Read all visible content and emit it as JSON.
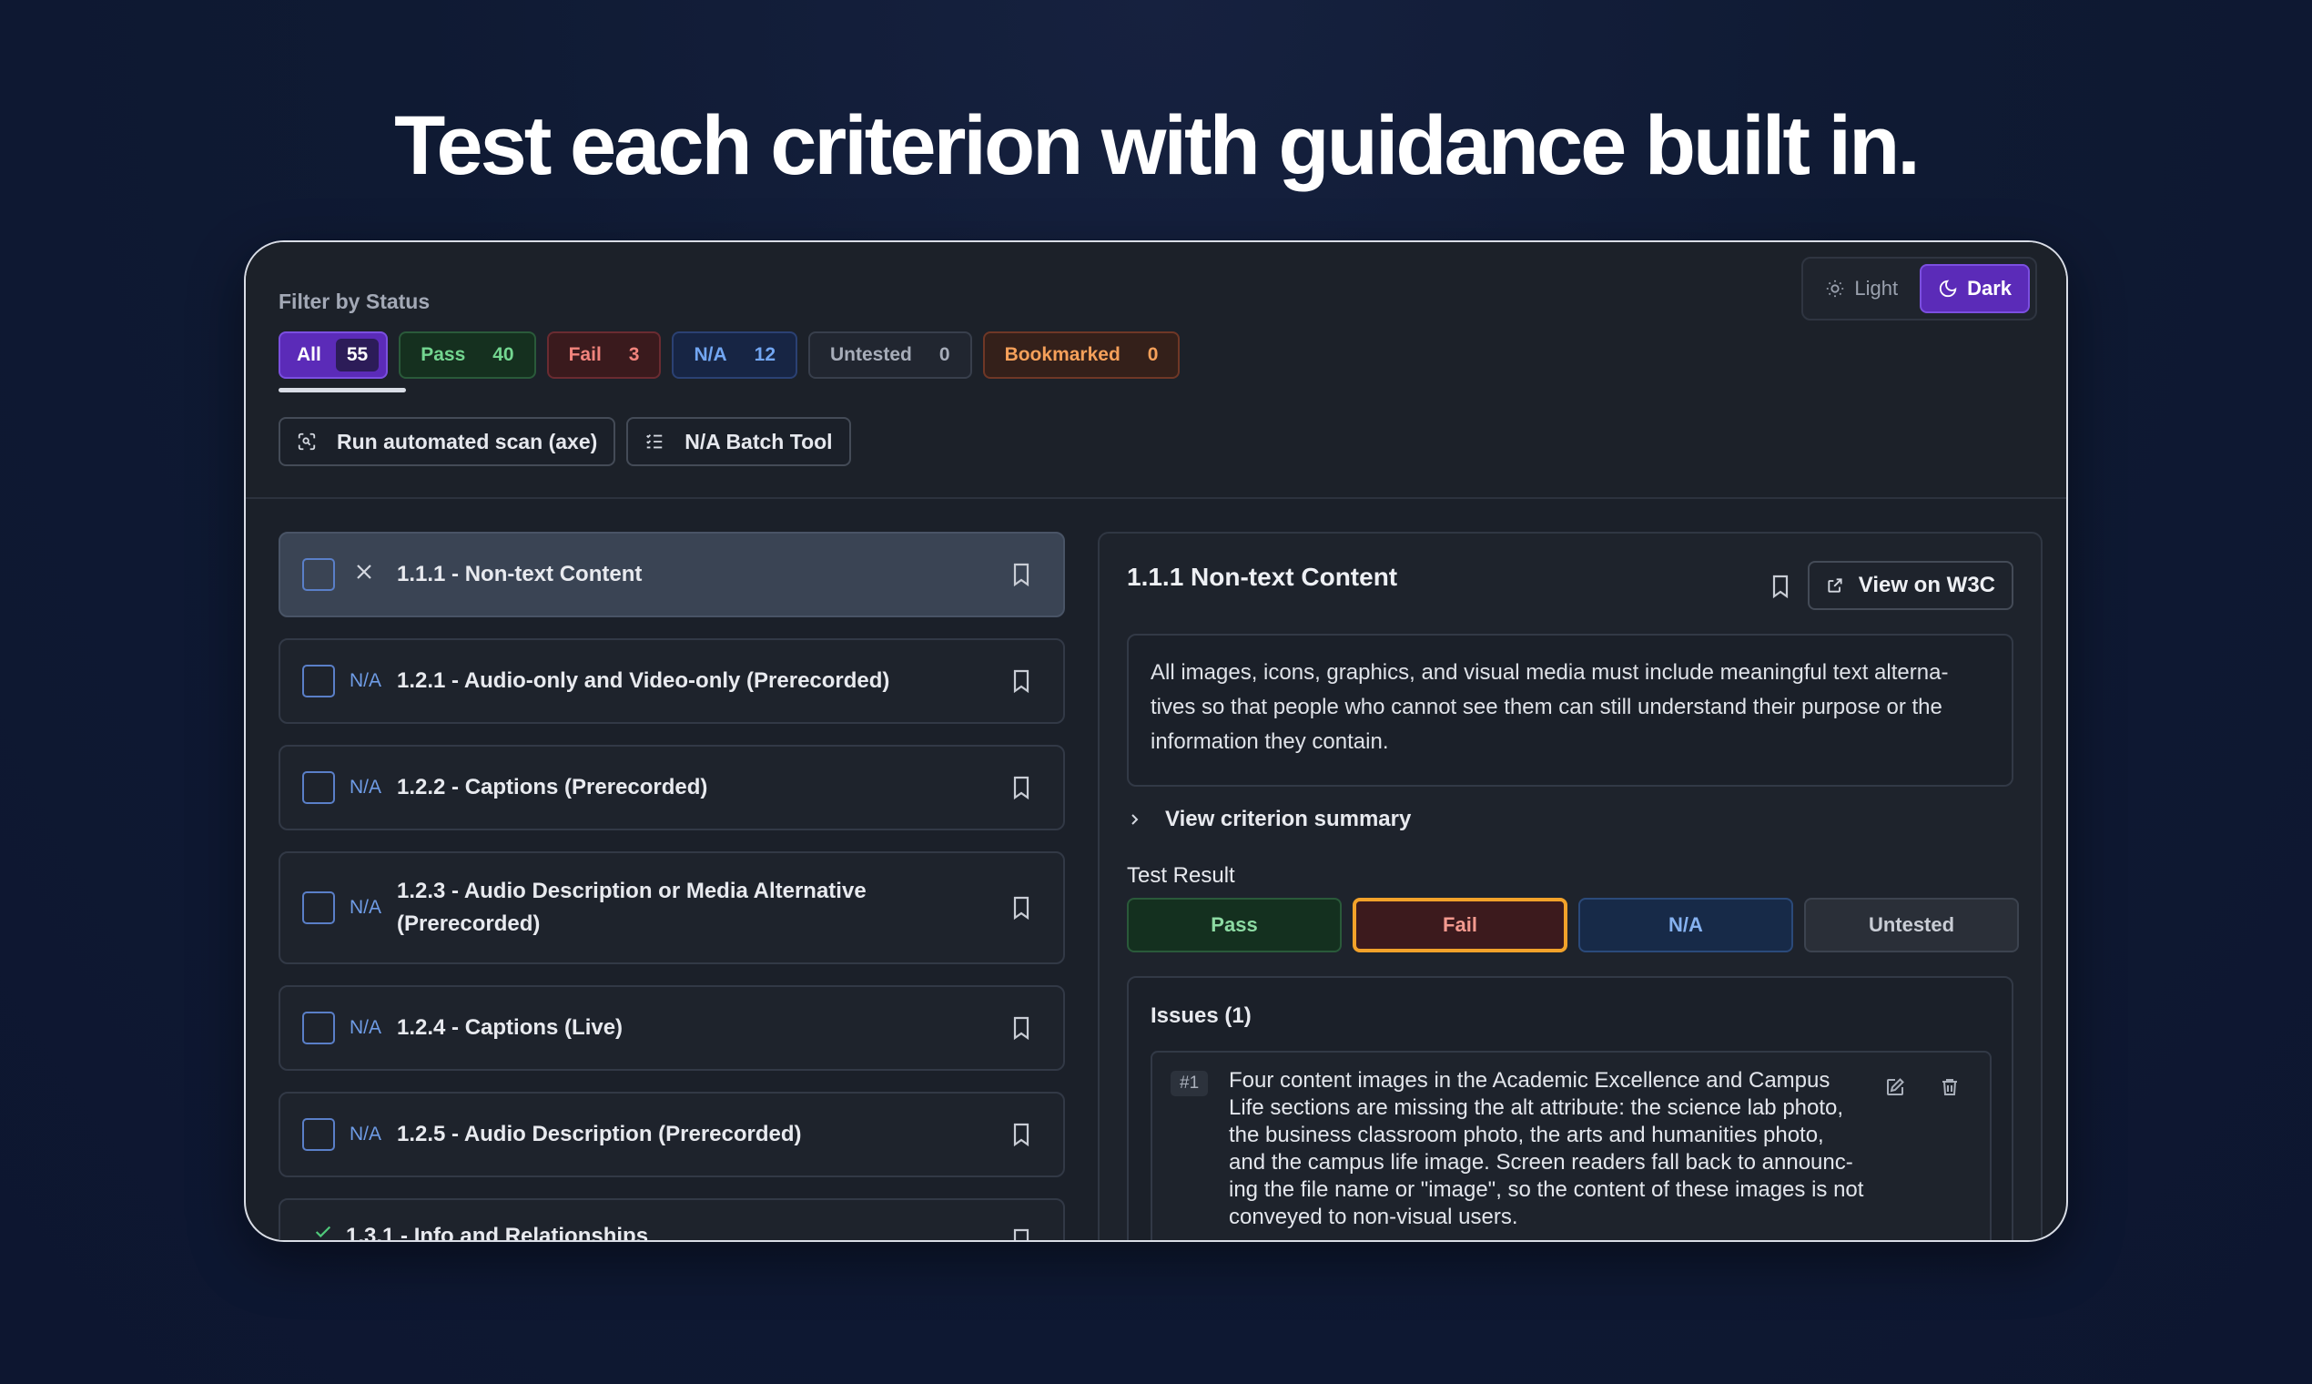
{
  "headline": "Test each criterion with guidance built in.",
  "theme": {
    "light_label": "Light",
    "dark_label": "Dark"
  },
  "filter": {
    "label": "Filter by Status",
    "chips": [
      {
        "label": "All",
        "count": "55"
      },
      {
        "label": "Pass",
        "count": "40"
      },
      {
        "label": "Fail",
        "count": "3"
      },
      {
        "label": "N/A",
        "count": "12"
      },
      {
        "label": "Untested",
        "count": "0"
      },
      {
        "label": "Bookmarked",
        "count": "0"
      }
    ]
  },
  "tools": {
    "scan_label": "Run automated scan (axe)",
    "batch_label": "N/A Batch Tool"
  },
  "criteria": [
    {
      "status": "",
      "title": "1.1.1 - Non-text Content"
    },
    {
      "status": "N/A",
      "title": "1.2.1 - Audio-only and Video-only (Prerecorded)"
    },
    {
      "status": "N/A",
      "title": "1.2.2 - Captions (Prerecorded)"
    },
    {
      "status": "N/A",
      "title": "1.2.3 - Audio Description or Media Alternative (Prerecorded)"
    },
    {
      "status": "N/A",
      "title": "1.2.4 - Captions (Live)"
    },
    {
      "status": "N/A",
      "title": "1.2.5 - Audio Description (Prerecorded)"
    },
    {
      "status": "",
      "title": "1.3.1 - Info and Relationships"
    }
  ],
  "detail": {
    "title": "1.1.1 Non-text Content",
    "w3c_label": "View on W3C",
    "description": "All images, icons, graphics, and visual media must include meaningful text alterna-tives so that people who cannot see them can still understand their purpose or the information they contain.",
    "summary_label": "View criterion summary",
    "result_label": "Test Result",
    "results": {
      "pass": "Pass",
      "fail": "Fail",
      "na": "N/A",
      "untested": "Untested"
    },
    "issues_title": "Issues (1)",
    "issue": {
      "num": "#1",
      "text": "Four content images in the Academic Excellence and Campus Life sections are missing the alt attribute: the science lab photo, the business classroom photo, the arts and humanities photo, and the campus life image. Screen readers fall back to announc-ing the file name or \"image\", so the content of these images is not conveyed to non-visual users."
    }
  }
}
